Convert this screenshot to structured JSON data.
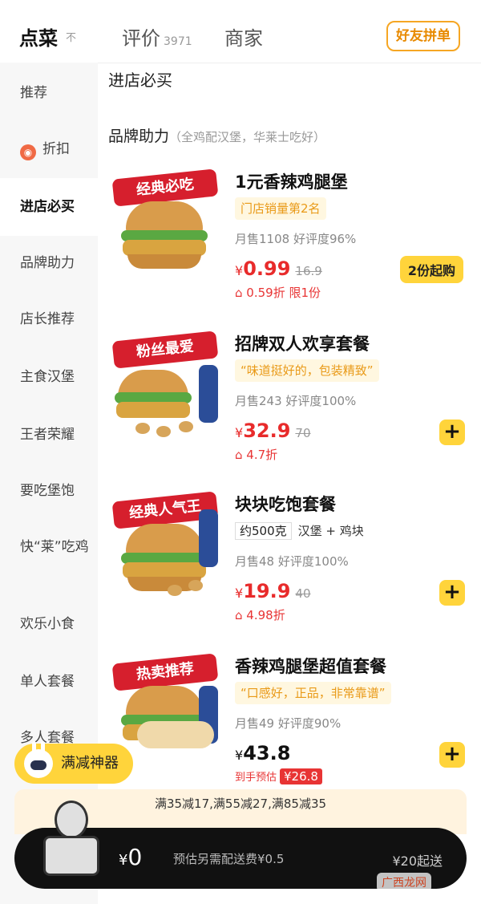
{
  "tabs": [
    {
      "label": "点菜",
      "active": true,
      "pin": "不"
    },
    {
      "label": "评价",
      "count": "3971"
    },
    {
      "label": "商家"
    }
  ],
  "topbar": {
    "friend_order": "好友拼单"
  },
  "sidebar": [
    {
      "label": "推荐"
    },
    {
      "label": "折扣",
      "icon": "discount-tag-icon"
    },
    {
      "label": "进店必买",
      "active": true
    },
    {
      "label": "品牌助力"
    },
    {
      "label": "店长推荐"
    },
    {
      "label": "主食汉堡"
    },
    {
      "label": "王者荣耀"
    },
    {
      "label": "要吃堡饱"
    },
    {
      "label": "快“莱”吃鸡"
    },
    {
      "label": "欢乐小食"
    },
    {
      "label": "单人套餐"
    },
    {
      "label": "多人套餐"
    }
  ],
  "main": {
    "section_title": "进店必买",
    "subsection_title": "品牌助力",
    "subsection_note": "（全鸡配汉堡，华莱士吃好）",
    "products": [
      {
        "banner": "经典必吃",
        "name": "1元香辣鸡腿堡",
        "tag": "门店销量第2名",
        "sales": "月售1108",
        "rating": "好评度96%",
        "currency": "¥",
        "price": "0.99",
        "old_price": "16.9",
        "discount": "0.59折",
        "limit": "限1份",
        "action": "2份起购"
      },
      {
        "banner": "粉丝最爱",
        "name": "招牌双人欢享套餐",
        "tag": "“味道挺好的，包装精致”",
        "sales": "月售243",
        "rating": "好评度100%",
        "currency": "¥",
        "price": "32.9",
        "old_price": "70",
        "discount": "4.7折",
        "action": "+"
      },
      {
        "banner": "经典人气王",
        "name": "块块吃饱套餐",
        "tag_box": "约500克",
        "tag_text": "汉堡 + 鸡块",
        "sales": "月售48",
        "rating": "好评度100%",
        "currency": "¥",
        "price": "19.9",
        "old_price": "40",
        "discount": "4.98折",
        "action": "+"
      },
      {
        "banner": "热卖推荐",
        "name": "香辣鸡腿堡超值套餐",
        "tag": "“口感好，正品，非常靠谱”",
        "sales": "月售49",
        "rating": "好评度90%",
        "currency": "¥",
        "price": "43.8",
        "estimate_label": "到手预估",
        "estimate_price": "¥26.8",
        "action": "+"
      }
    ]
  },
  "promo": {
    "label": "满减神器"
  },
  "full_reduction": "满35减17,满55减27,满85减35",
  "cart": {
    "currency": "¥",
    "amount": "0",
    "fee": "预估另需配送费¥0.5",
    "min_order": "¥20起送"
  },
  "watermark": "广西龙网"
}
